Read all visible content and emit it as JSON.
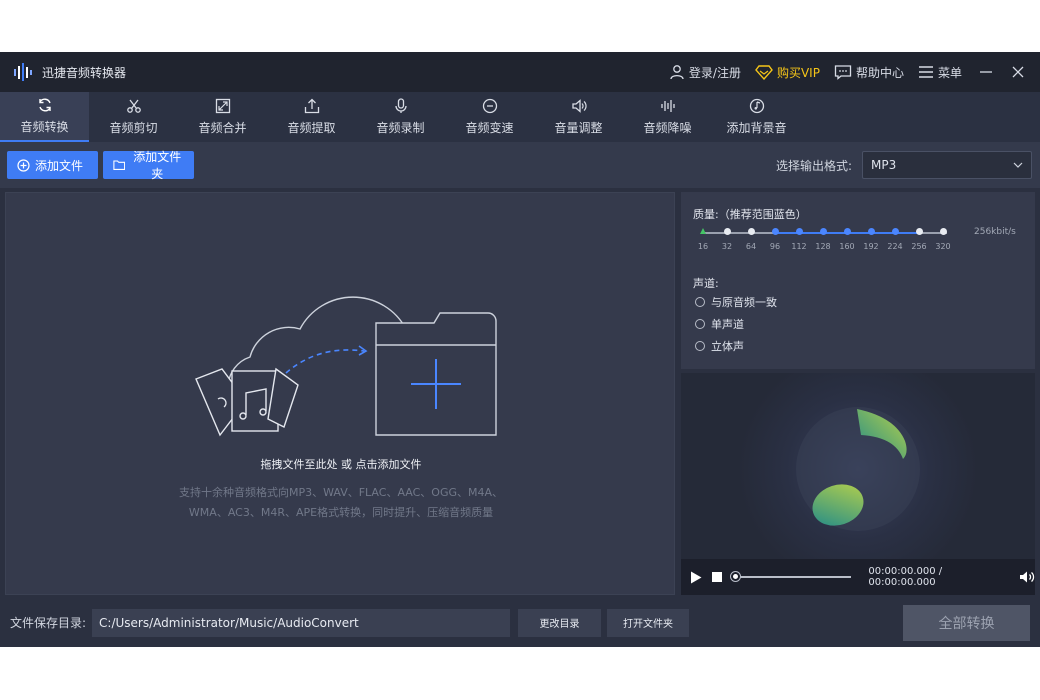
{
  "app": {
    "title": "迅捷音频转换器"
  },
  "header": {
    "login": "登录/注册",
    "vip": "购买VIP",
    "help": "帮助中心",
    "menu": "菜单"
  },
  "tabs": [
    {
      "label": "音频转换",
      "icon": "refresh-icon"
    },
    {
      "label": "音频剪切",
      "icon": "scissors-icon"
    },
    {
      "label": "音频合并",
      "icon": "merge-icon"
    },
    {
      "label": "音频提取",
      "icon": "extract-icon"
    },
    {
      "label": "音频录制",
      "icon": "microphone-icon"
    },
    {
      "label": "音频变速",
      "icon": "speed-icon"
    },
    {
      "label": "音量调整",
      "icon": "volume-icon"
    },
    {
      "label": "音频降噪",
      "icon": "waveform-icon"
    },
    {
      "label": "添加背景音",
      "icon": "music-note-icon"
    }
  ],
  "toolbar": {
    "add_file": "添加文件",
    "add_folder": "添加文件夹",
    "format_label": "选择输出格式:",
    "format_value": "MP3"
  },
  "dropzone": {
    "title": "拖拽文件至此处 或 点击添加文件",
    "desc_line1": "支持十余种音频格式向MP3、WAV、FLAC、AAC、OGG、M4A、",
    "desc_line2": "WMA、AC3、M4R、APE格式转换，同时提升、压缩音频质量"
  },
  "settings": {
    "quality_label": "质量:（推荐范围蓝色）",
    "quality_ticks": [
      "16",
      "32",
      "64",
      "96",
      "112",
      "128",
      "160",
      "192",
      "224",
      "256",
      "320"
    ],
    "quality_value": "256kbit/s",
    "channel_label": "声道:",
    "channels": [
      "与原音频一致",
      "单声道",
      "立体声"
    ]
  },
  "player": {
    "time": "00:00:00.000 / 00:00:00.000"
  },
  "bottom": {
    "save_label": "文件保存目录:",
    "save_path": "C:/Users/Administrator/Music/AudioConvert",
    "change_dir": "更改目录",
    "open_folder": "打开文件夹",
    "convert_all": "全部转换"
  },
  "colors": {
    "accent": "#3f7cf5",
    "vip": "#f5c518",
    "background": "#2b3040"
  }
}
